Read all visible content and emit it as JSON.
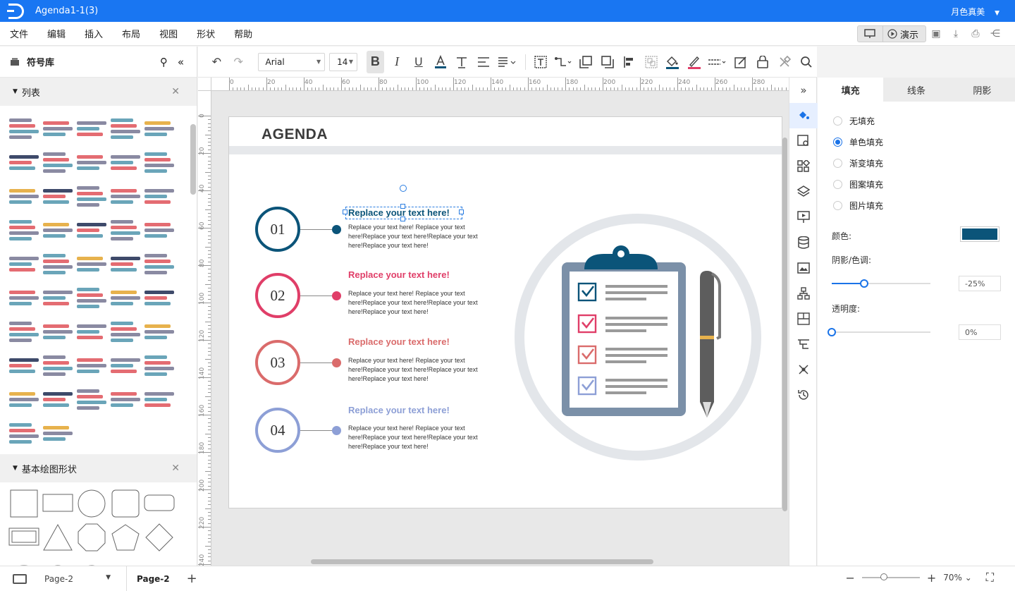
{
  "window": {
    "title": "Agenda1-1(3)",
    "user": "月色真美"
  },
  "menu": [
    "文件",
    "编辑",
    "插入",
    "布局",
    "视图",
    "形状",
    "帮助"
  ],
  "menu_right": {
    "present_label": "演示"
  },
  "left_panel": {
    "title": "符号库",
    "sections": [
      {
        "label": "列表"
      },
      {
        "label": "基本绘图形状"
      }
    ]
  },
  "toolbar": {
    "font": "Arial",
    "font_size": "14"
  },
  "ruler": {
    "h_ticks": [
      "0",
      "20",
      "40",
      "60",
      "80",
      "100",
      "120",
      "140",
      "160",
      "180",
      "200",
      "220",
      "240",
      "260",
      "280"
    ],
    "v_ticks": [
      "0",
      "20",
      "40",
      "60",
      "80",
      "100",
      "120",
      "140",
      "160",
      "180",
      "200",
      "220",
      "240"
    ]
  },
  "slide": {
    "title": "AGENDA",
    "items": [
      {
        "num": "01",
        "title": "Replace your text here!",
        "body": "Replace your text here!  Replace your text here!Replace your text here!Replace your text here!Replace your text here!",
        "color": "#0b5479"
      },
      {
        "num": "02",
        "title": "Replace your text here!",
        "body": "Replace your text here!  Replace your text here!Replace your text here!Replace your text here!Replace your text here!",
        "color": "#e03e68"
      },
      {
        "num": "03",
        "title": "Replace your text here!",
        "body": "Replace your text here!  Replace your text here!Replace your text here!Replace your text here!Replace your text here!",
        "color": "#da6b6b"
      },
      {
        "num": "04",
        "title": "Replace your text here!",
        "body": "Replace your text here!  Replace your text here!Replace your text here!Replace your text here!Replace your text here!",
        "color": "#8d9fd6"
      }
    ]
  },
  "right_panel": {
    "tabs": [
      "填充",
      "线条",
      "阴影"
    ],
    "fill_options": [
      "无填充",
      "单色填充",
      "渐变填充",
      "图案填充",
      "图片填充"
    ],
    "selected_fill": "单色填充",
    "color_label": "颜色:",
    "color_value": "#0b5479",
    "shade_label": "阴影/色调:",
    "shade_value": "-25%",
    "opacity_label": "透明度:",
    "opacity_value": "0%"
  },
  "bottom": {
    "page_select": "Page-2",
    "page_tab": "Page-2",
    "zoom": "70%"
  }
}
